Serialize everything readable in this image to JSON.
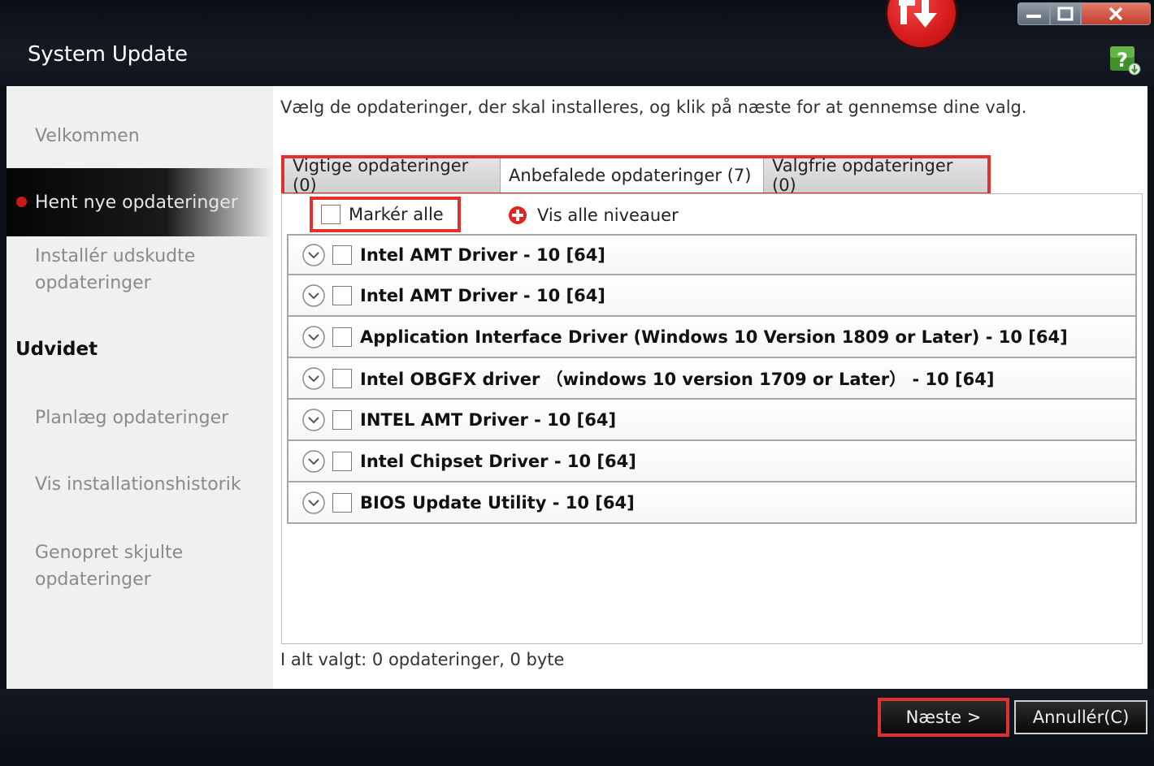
{
  "app": {
    "title": "System Update"
  },
  "sidebar": {
    "items": [
      {
        "label": "Velkommen"
      },
      {
        "label": "Hent nye opdateringer"
      },
      {
        "label": "Installér udskudte opdateringer",
        "line1": "Installér udskudte",
        "line2": "opdateringer"
      },
      {
        "label": "Planlæg opdateringer"
      },
      {
        "label": "Vis installationshistorik"
      },
      {
        "label": "Genopret skjulte opdateringer",
        "line1": "Genopret skjulte",
        "line2": "opdateringer"
      }
    ],
    "section_heading": "Udvidet"
  },
  "content": {
    "instruction": "Vælg de opdateringer, der skal installeres, og klik på næste for at gennemse dine valg.",
    "tabs": [
      {
        "label": "Vigtige opdateringer (0)"
      },
      {
        "label": "Anbefalede opdateringer (7)"
      },
      {
        "label": "Valgfrie opdateringer (0)"
      }
    ],
    "select_all_label": "Markér alle",
    "show_levels_label": "Vis alle niveauer",
    "updates": [
      {
        "title": "Intel AMT Driver - 10 [64]"
      },
      {
        "title": "Intel AMT Driver - 10 [64]"
      },
      {
        "title": "Application Interface Driver (Windows 10 Version 1809 or Later) - 10 [64]"
      },
      {
        "title": "Intel OBGFX driver （windows 10 version 1709 or Later） - 10 [64]"
      },
      {
        "title": "INTEL AMT Driver - 10 [64]"
      },
      {
        "title": "Intel Chipset Driver - 10 [64]"
      },
      {
        "title": "BIOS Update Utility - 10 [64]"
      }
    ],
    "summary": "I alt valgt: 0 opdateringer,  0 byte"
  },
  "footer": {
    "next_label": "Næste >",
    "cancel_label": "Annullér(C)"
  },
  "colors": {
    "highlight": "#e03030",
    "window_dark": "#0d1118",
    "active_dot": "#c81a1a"
  }
}
